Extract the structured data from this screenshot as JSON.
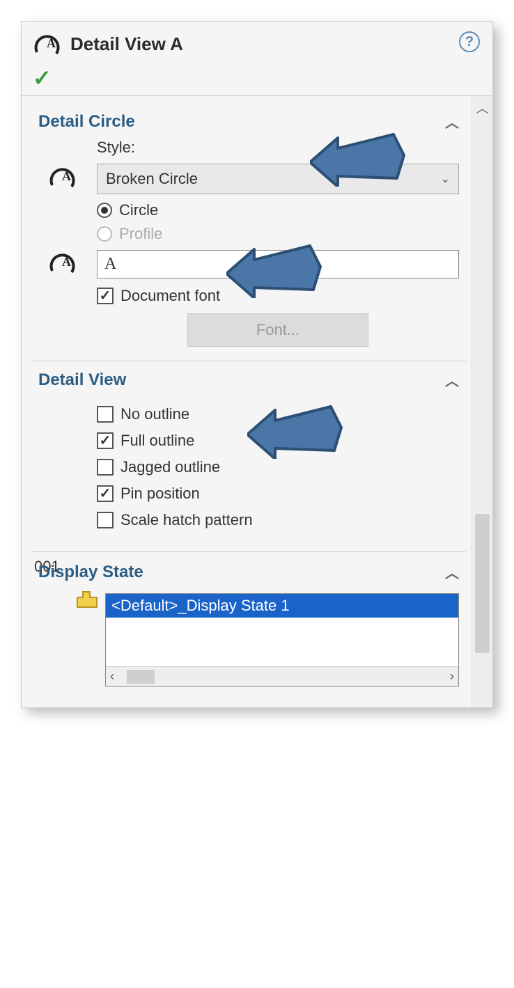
{
  "header": {
    "title": "Detail View A",
    "help": "?"
  },
  "sections": {
    "detailCircle": {
      "title": "Detail Circle",
      "styleLabel": "Style:",
      "styleValue": "Broken Circle",
      "radioCircle": "Circle",
      "radioProfile": "Profile",
      "nameValue": "A",
      "docFont": "Document font",
      "fontBtn": "Font..."
    },
    "detailView": {
      "title": "Detail View",
      "noOutline": "No outline",
      "fullOutline": "Full outline",
      "jaggedOutline": "Jagged outline",
      "pinPosition": "Pin position",
      "scaleHatch": "Scale hatch pattern"
    },
    "displayState": {
      "title": "Display State",
      "item": "<Default>_Display State 1"
    }
  }
}
